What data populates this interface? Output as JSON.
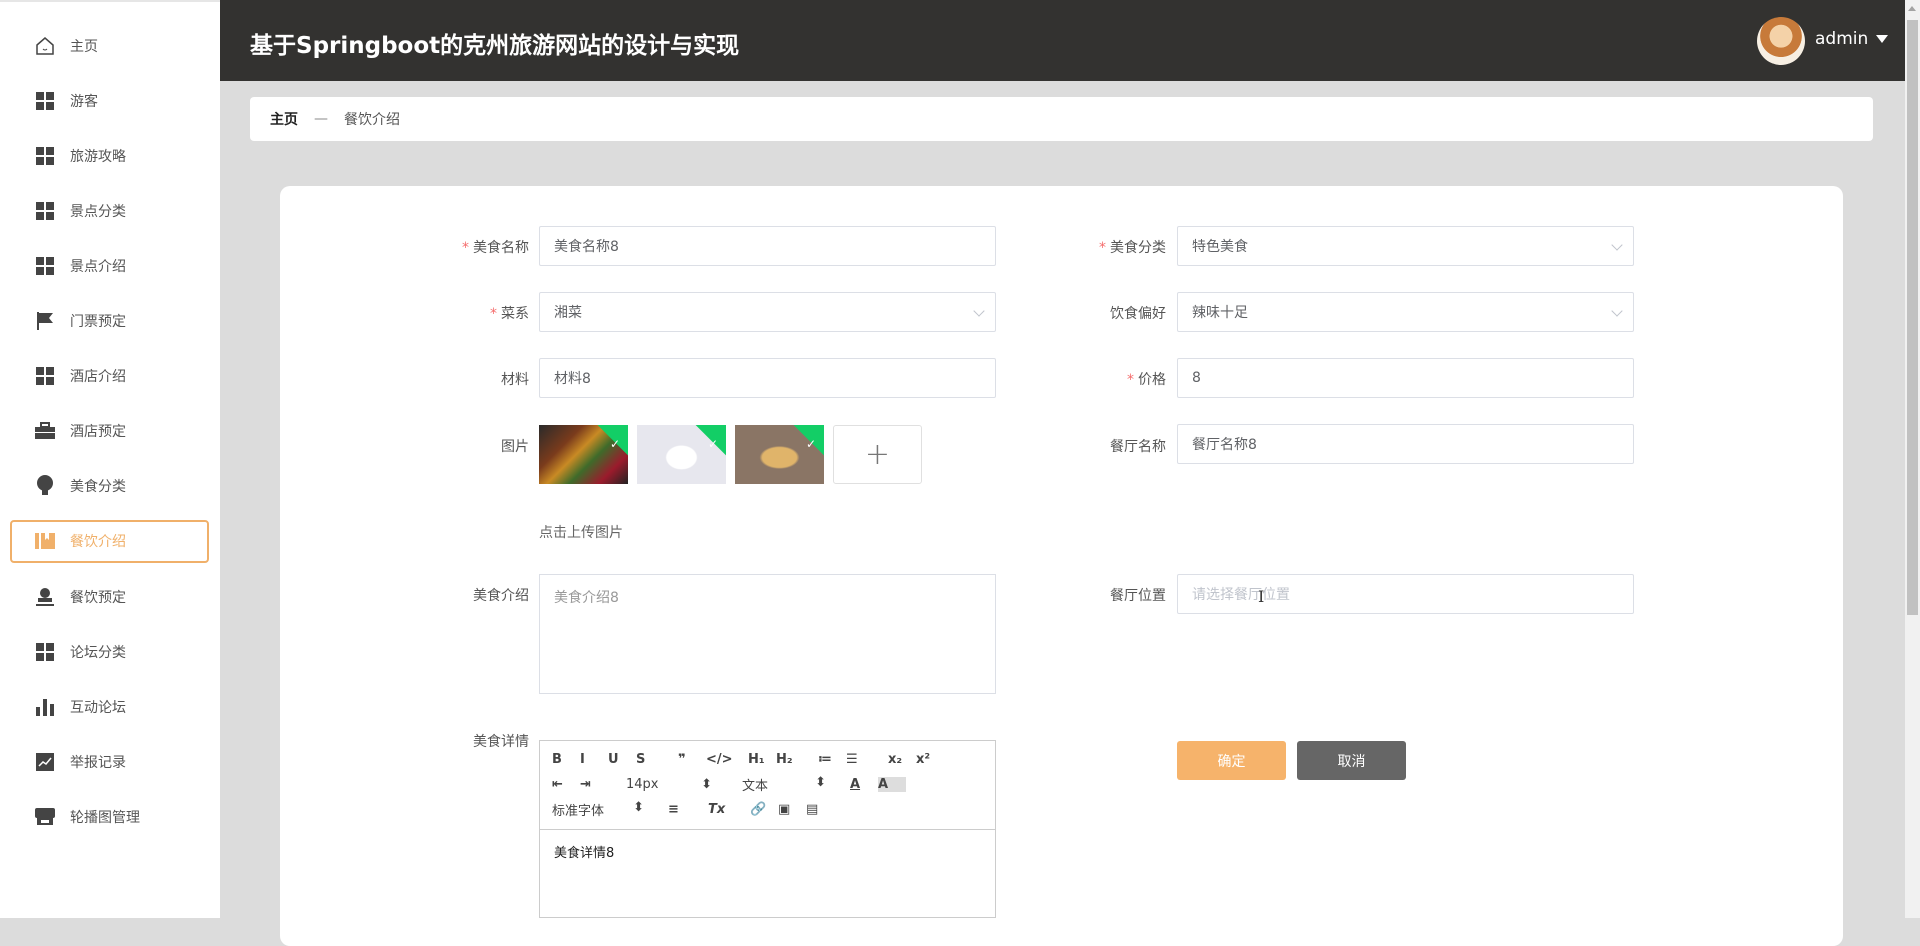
{
  "app_title": "基于Springboot的克州旅游网站的设计与实现",
  "user": {
    "name": "admin"
  },
  "sidebar": {
    "items": [
      {
        "label": "主页",
        "icon": "home-icon"
      },
      {
        "label": "游客",
        "icon": "grid-icon"
      },
      {
        "label": "旅游攻略",
        "icon": "grid-icon"
      },
      {
        "label": "景点分类",
        "icon": "grid-icon"
      },
      {
        "label": "景点介绍",
        "icon": "grid-icon"
      },
      {
        "label": "门票预定",
        "icon": "flag-icon"
      },
      {
        "label": "酒店介绍",
        "icon": "grid-icon"
      },
      {
        "label": "酒店预定",
        "icon": "briefcase-icon"
      },
      {
        "label": "美食分类",
        "icon": "bulb-icon"
      },
      {
        "label": "餐饮介绍",
        "icon": "book-icon",
        "active": true
      },
      {
        "label": "餐饮预定",
        "icon": "stamp-icon"
      },
      {
        "label": "论坛分类",
        "icon": "grid-icon"
      },
      {
        "label": "互动论坛",
        "icon": "bar-chart-icon"
      },
      {
        "label": "举报记录",
        "icon": "line-chart-icon"
      },
      {
        "label": "轮播图管理",
        "icon": "store-icon"
      }
    ]
  },
  "breadcrumb": {
    "home": "主页",
    "sep": "—",
    "current": "餐饮介绍"
  },
  "form": {
    "name": {
      "label": "美食名称",
      "value": "美食名称8"
    },
    "category": {
      "label": "美食分类",
      "value": "特色美食"
    },
    "cuisine": {
      "label": "菜系",
      "value": "湘菜"
    },
    "preference": {
      "label": "饮食偏好",
      "value": "辣味十足"
    },
    "material": {
      "label": "材料",
      "value": "材料8"
    },
    "price": {
      "label": "价格",
      "value": "8"
    },
    "picture": {
      "label": "图片",
      "upload_hint": "点击上传图片",
      "plus": "+",
      "check": "✓"
    },
    "restaurant": {
      "label": "餐厅名称",
      "value": "餐厅名称8"
    },
    "intro": {
      "label": "美食介绍",
      "value": "美食介绍8"
    },
    "location": {
      "label": "餐厅位置",
      "placeholder": "请选择餐厅位置"
    },
    "detail": {
      "label": "美食详情",
      "value": "美食详情8"
    },
    "required_mark": "*",
    "confirm": "确定",
    "cancel": "取消"
  },
  "editor": {
    "size": "14px",
    "header": "文本",
    "font": "标准字体",
    "buttons": [
      "B",
      "I",
      "U",
      "S",
      "❞",
      "</>",
      "H₁",
      "H₂",
      "≔",
      "☰",
      "x₂",
      "x²"
    ]
  },
  "colors": {
    "accent": "#f0b06a",
    "header": "#333230",
    "confirm": "#f6b36b",
    "cancel": "#666666"
  }
}
